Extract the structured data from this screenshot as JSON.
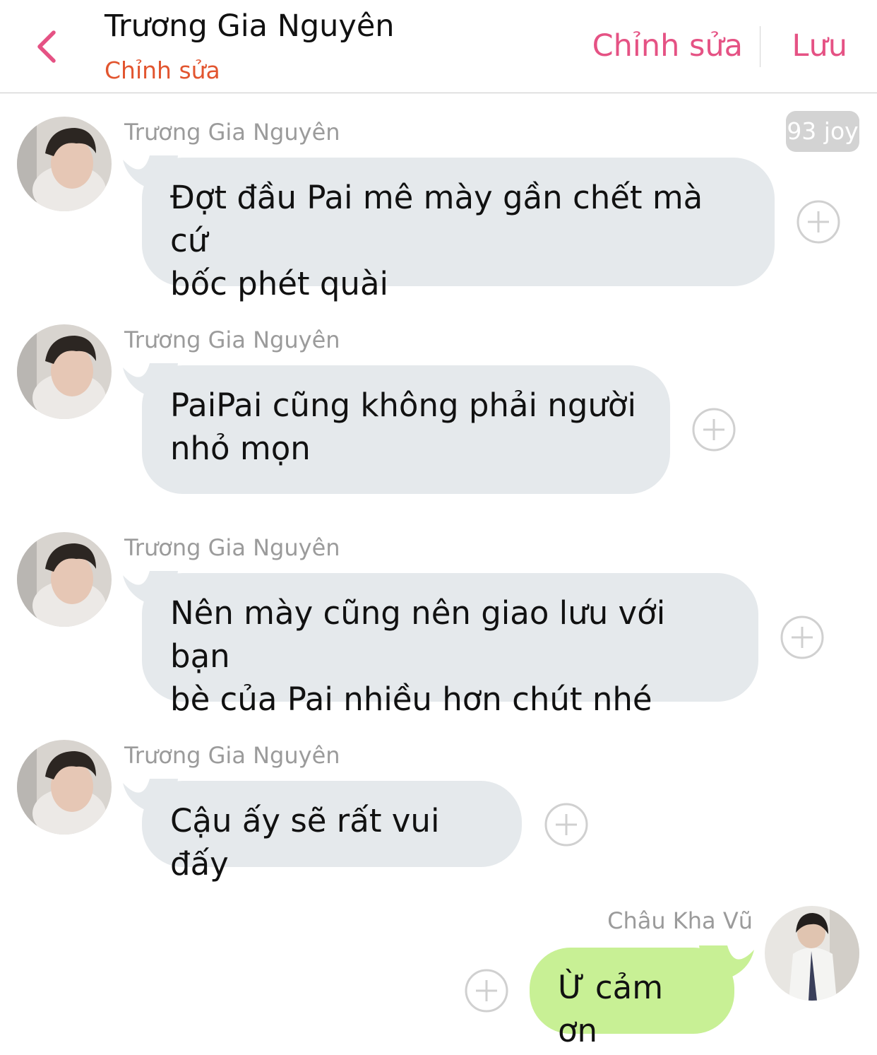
{
  "header": {
    "title": "Trương Gia Nguyên",
    "subtitle": "Chỉnh sửa",
    "edit_label": "Chỉnh sửa",
    "save_label": "Lưu",
    "accent_color": "#e55284",
    "subtitle_color": "#e2552f",
    "back_icon": "chevron-left-icon"
  },
  "badge": "93 joy",
  "messages": [
    {
      "sender": "Trương Gia Nguyên",
      "lines": [
        "Đợt đầu Pai mê mày gần chết mà cứ",
        "bốc phét quài"
      ],
      "side": "left"
    },
    {
      "sender": "Trương Gia Nguyên",
      "lines": [
        "PaiPai cũng không phải người",
        "nhỏ mọn"
      ],
      "side": "left"
    },
    {
      "sender": "Trương Gia Nguyên",
      "lines": [
        "Nên mày cũng nên giao lưu với bạn",
        "bè của Pai nhiều hơn chút nhé"
      ],
      "side": "left"
    },
    {
      "sender": "Trương Gia Nguyên",
      "lines": [
        "Cậu ấy sẽ rất vui đấy"
      ],
      "side": "left"
    },
    {
      "sender": "Châu Kha Vũ",
      "lines": [
        "Ừ cảm ơn"
      ],
      "side": "right"
    }
  ],
  "colors": {
    "incoming_bubble": "#e5e9ec",
    "outgoing_bubble": "#c8f095",
    "sender_name": "#9b9b9b"
  }
}
